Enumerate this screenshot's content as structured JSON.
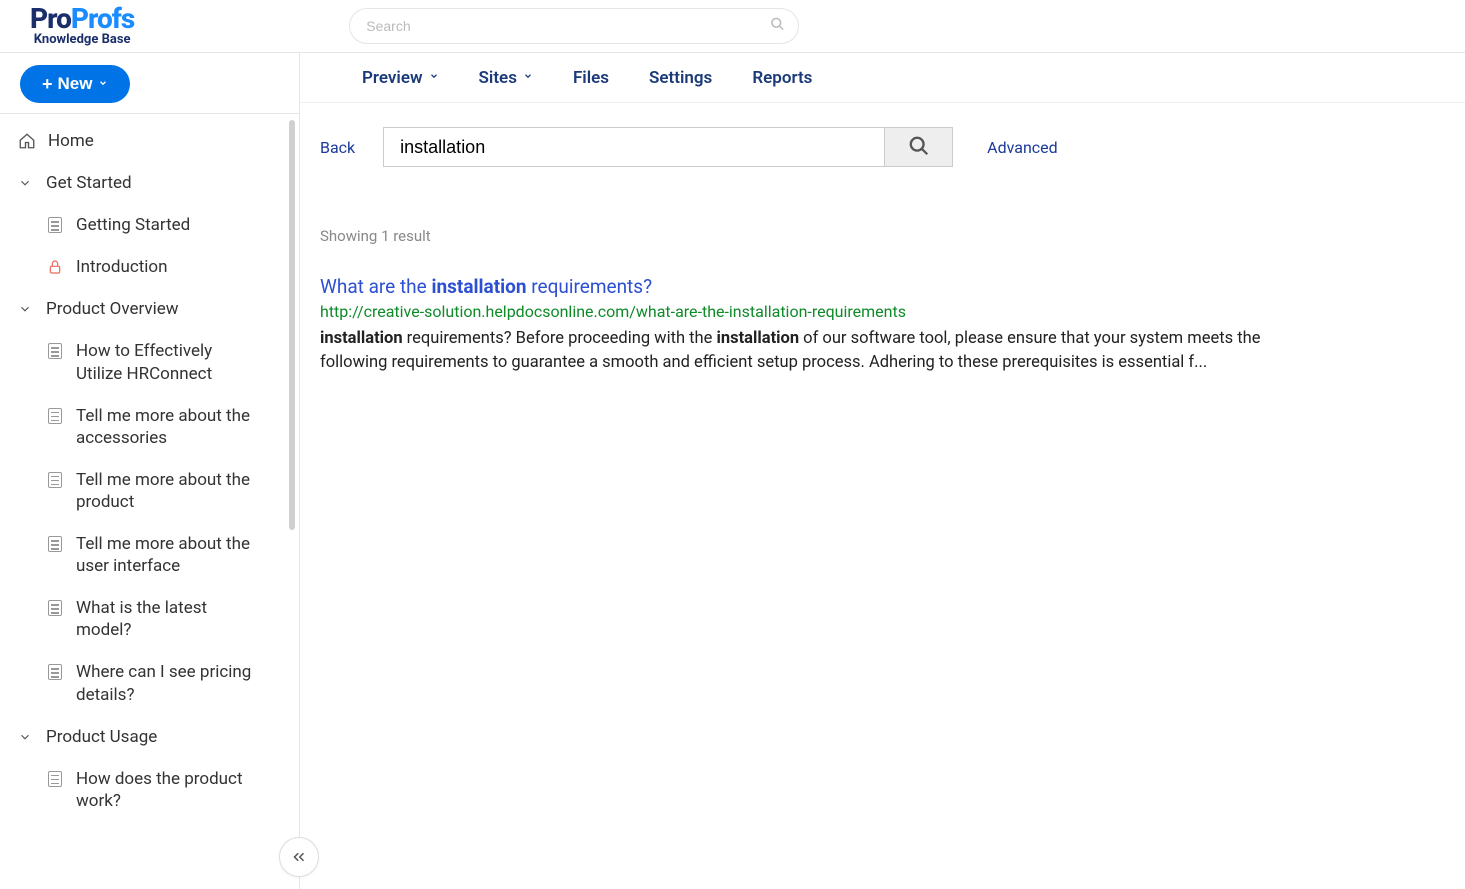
{
  "brand": {
    "pro": "Pro",
    "profs": "Profs",
    "sub": "Knowledge Base"
  },
  "topSearch": {
    "placeholder": "Search"
  },
  "newBtn": {
    "label": "New"
  },
  "tree": {
    "home": "Home",
    "sections": [
      {
        "label": "Get Started",
        "items": [
          {
            "label": "Getting Started",
            "icon": "doc"
          },
          {
            "label": "Introduction",
            "icon": "lock"
          }
        ]
      },
      {
        "label": "Product Overview",
        "items": [
          {
            "label": "How to Effectively Utilize HRConnect",
            "icon": "doc"
          },
          {
            "label": "Tell me more about the accessories",
            "icon": "doc"
          },
          {
            "label": "Tell me more about the product",
            "icon": "doc"
          },
          {
            "label": "Tell me more about the user interface",
            "icon": "doc"
          },
          {
            "label": "What is the latest model?",
            "icon": "doc"
          },
          {
            "label": "Where can I see pricing details?",
            "icon": "doc"
          }
        ]
      },
      {
        "label": "Product Usage",
        "items": [
          {
            "label": "How does the product work?",
            "icon": "doc"
          }
        ]
      }
    ]
  },
  "topnav": {
    "preview": "Preview",
    "sites": "Sites",
    "files": "Files",
    "settings": "Settings",
    "reports": "Reports"
  },
  "search": {
    "back": "Back",
    "value": "installation",
    "advanced": "Advanced"
  },
  "results": {
    "showing": "Showing 1 result",
    "items": [
      {
        "titlePre": "What are the ",
        "titleBold": "installation",
        "titlePost": " requirements?",
        "url": "http://creative-solution.helpdocsonline.com/what-are-the-installation-requirements",
        "snipBold1": "installation",
        "snipP1": " requirements? Before proceeding with the ",
        "snipBold2": "installation",
        "snipP2": " of our software tool, please ensure that your system meets the following requirements to guarantee a smooth and efficient setup process. Adhering to these prerequisites is essential f..."
      }
    ]
  }
}
